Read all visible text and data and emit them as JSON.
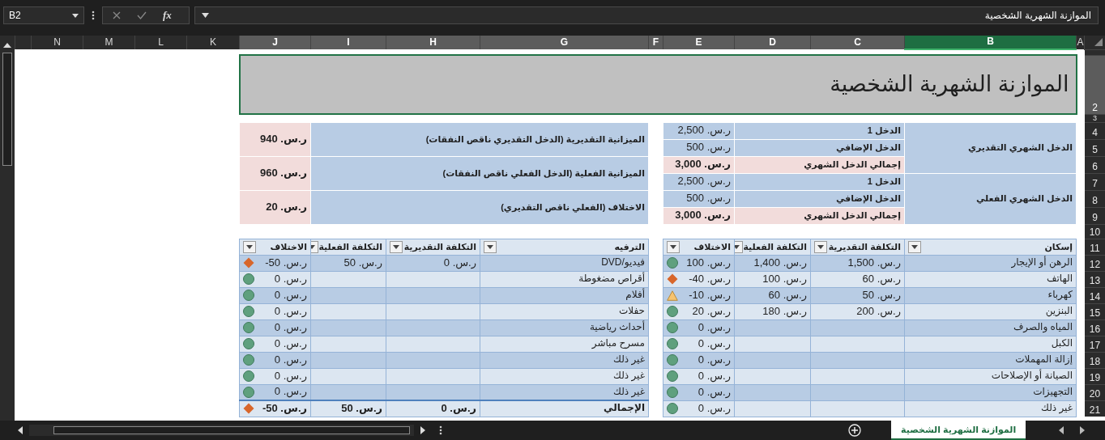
{
  "name_box": "B2",
  "insert_function": "fx",
  "formula": "الموازنة الشهرية الشخصية",
  "columns": [
    {
      "label": "A",
      "selected": false,
      "active": false
    },
    {
      "label": "B",
      "selected": true,
      "active": true
    },
    {
      "label": "C",
      "selected": true,
      "active": false
    },
    {
      "label": "D",
      "selected": true,
      "active": false
    },
    {
      "label": "E",
      "selected": true,
      "active": false
    },
    {
      "label": "F",
      "selected": true,
      "active": false
    },
    {
      "label": "G",
      "selected": true,
      "active": false
    },
    {
      "label": "H",
      "selected": true,
      "active": false
    },
    {
      "label": "I",
      "selected": true,
      "active": false
    },
    {
      "label": "J",
      "selected": true,
      "active": false
    },
    {
      "label": "K",
      "selected": false,
      "active": false
    },
    {
      "label": "L",
      "selected": false,
      "active": false
    },
    {
      "label": "M",
      "selected": false,
      "active": false
    },
    {
      "label": "N",
      "selected": false,
      "active": false
    }
  ],
  "rows": [
    {
      "label": "2",
      "selected": true
    },
    {
      "label": "3",
      "selected": false
    },
    {
      "label": "4",
      "selected": false
    },
    {
      "label": "5",
      "selected": false
    },
    {
      "label": "6",
      "selected": false
    },
    {
      "label": "7",
      "selected": false
    },
    {
      "label": "8",
      "selected": false
    },
    {
      "label": "9",
      "selected": false
    },
    {
      "label": "10",
      "selected": false
    },
    {
      "label": "11",
      "selected": false
    },
    {
      "label": "12",
      "selected": false
    },
    {
      "label": "13",
      "selected": false
    },
    {
      "label": "14",
      "selected": false
    },
    {
      "label": "15",
      "selected": false
    },
    {
      "label": "16",
      "selected": false
    },
    {
      "label": "17",
      "selected": false
    },
    {
      "label": "18",
      "selected": false
    },
    {
      "label": "19",
      "selected": false
    },
    {
      "label": "20",
      "selected": false
    },
    {
      "label": "21",
      "selected": false
    }
  ],
  "title": "الموازنة الشهرية الشخصية",
  "income": [
    {
      "label": "الدخل الشهري التقديري",
      "lines": [
        {
          "label": "الدخل 1",
          "amount": "ر.س. 2,500",
          "total": false
        },
        {
          "label": "الدخل الإضافي",
          "amount": "ر.س. 500",
          "total": false
        },
        {
          "label": "إجمالي الدخل الشهري",
          "amount": "ر.س. 3,000",
          "total": true
        }
      ]
    },
    {
      "label": "الدخل الشهري الفعلي",
      "lines": [
        {
          "label": "الدخل 1",
          "amount": "ر.س. 2,500",
          "total": false
        },
        {
          "label": "الدخل الإضافي",
          "amount": "ر.س. 500",
          "total": false
        },
        {
          "label": "إجمالي الدخل الشهري",
          "amount": "ر.س. 3,000",
          "total": true
        }
      ]
    }
  ],
  "summary": [
    {
      "label": "الميزانية التقديرية (الدخل التقديري ناقص النفقات)",
      "amount": "ر.س. 940"
    },
    {
      "label": "الميزانية الفعلية (الدخل الفعلي ناقص النفقات)",
      "amount": "ر.س. 960"
    },
    {
      "label": "الاختلاف (الفعلي ناقص التقديري)",
      "amount": "ر.س. 20"
    }
  ],
  "tables": [
    {
      "columns": [
        "إسكان",
        "التكلفة التقديرية",
        "التكلفة الفعلية",
        "الاختلاف"
      ],
      "rows": [
        {
          "name": "الرهن أو الإيجار",
          "estimated": "ر.س. 1,500",
          "actual": "ر.س. 1,400",
          "variance": "ر.س. 100",
          "kind": "circle",
          "total": false
        },
        {
          "name": "الهاتف",
          "estimated": "ر.س. 60",
          "actual": "ر.س. 100",
          "variance": "ر.س. 40-",
          "kind": "diamond",
          "total": false
        },
        {
          "name": "كهرباء",
          "estimated": "ر.س. 50",
          "actual": "ر.س. 60",
          "variance": "ر.س. 10-",
          "kind": "triangle",
          "total": false
        },
        {
          "name": "البنزين",
          "estimated": "ر.س. 200",
          "actual": "ر.س. 180",
          "variance": "ر.س. 20",
          "kind": "circle",
          "total": false
        },
        {
          "name": "المياه والصرف",
          "variance": "ر.س. 0",
          "kind": "circle",
          "total": false
        },
        {
          "name": "الكبل",
          "variance": "ر.س. 0",
          "kind": "circle",
          "total": false
        },
        {
          "name": "إزالة المهملات",
          "variance": "ر.س. 0",
          "kind": "circle",
          "total": false
        },
        {
          "name": "الصيانة أو الإصلاحات",
          "variance": "ر.س. 0",
          "kind": "circle",
          "total": false
        },
        {
          "name": "التجهيزات",
          "variance": "ر.س. 0",
          "kind": "circle",
          "total": false
        },
        {
          "name": "غير ذلك",
          "variance": "ر.س. 0",
          "kind": "circle",
          "total": false
        }
      ]
    },
    {
      "columns": [
        "الترفيه",
        "التكلفة التقديرية",
        "التكلفة الفعلية",
        "الاختلاف"
      ],
      "rows": [
        {
          "name": "فيديو/DVD",
          "estimated": "ر.س. 0",
          "actual": "ر.س. 50",
          "variance": "ر.س. 50-",
          "kind": "diamond",
          "total": false
        },
        {
          "name": "أقراص مضغوطة",
          "variance": "ر.س. 0",
          "kind": "circle",
          "total": false
        },
        {
          "name": "أفلام",
          "variance": "ر.س. 0",
          "kind": "circle",
          "total": false
        },
        {
          "name": "حفلات",
          "variance": "ر.س. 0",
          "kind": "circle",
          "total": false
        },
        {
          "name": "أحداث رياضية",
          "variance": "ر.س. 0",
          "kind": "circle",
          "total": false
        },
        {
          "name": "مسرح مباشر",
          "variance": "ر.س. 0",
          "kind": "circle",
          "total": false
        },
        {
          "name": "غير ذلك",
          "variance": "ر.س. 0",
          "kind": "circle",
          "total": false
        },
        {
          "name": "غير ذلك",
          "variance": "ر.س. 0",
          "kind": "circle",
          "total": false
        },
        {
          "name": "غير ذلك",
          "variance": "ر.س. 0",
          "kind": "circle",
          "total": false
        },
        {
          "name": "الإجمالي",
          "estimated": "ر.س. 0",
          "actual": "ر.س. 50",
          "variance": "ر.س. 50-",
          "kind": "diamond",
          "total": true
        }
      ]
    }
  ],
  "sheet_tab": {
    "label": "الموازنة الشهرية الشخصية",
    "selected": true
  }
}
